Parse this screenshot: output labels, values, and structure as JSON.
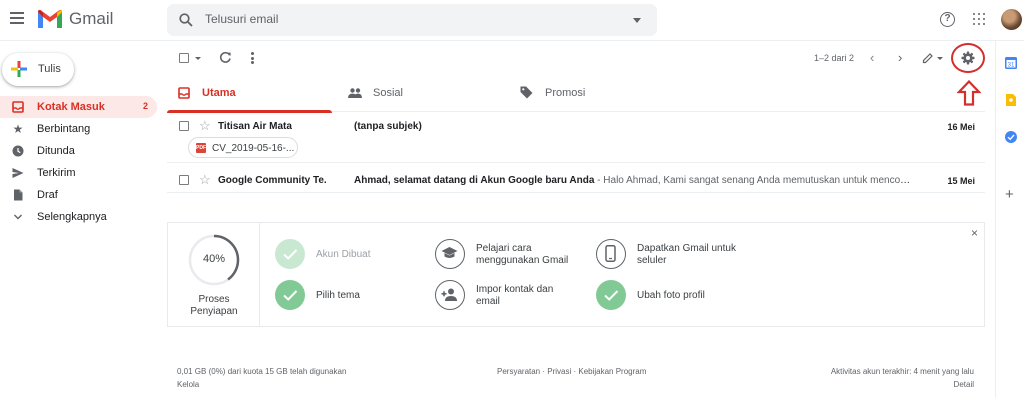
{
  "header": {
    "app_name": "Gmail",
    "search_placeholder": "Telusuri email",
    "help_label": "?"
  },
  "sidebar": {
    "compose_label": "Tulis",
    "items": [
      {
        "label": "Kotak Masuk",
        "count": "2",
        "icon": "inbox-icon",
        "active": true
      },
      {
        "label": "Berbintang",
        "icon": "star-icon"
      },
      {
        "label": "Ditunda",
        "icon": "clock-icon"
      },
      {
        "label": "Terkirim",
        "icon": "send-icon"
      },
      {
        "label": "Draf",
        "icon": "draft-icon"
      },
      {
        "label": "Selengkapnya",
        "icon": "chevron-down-icon"
      }
    ]
  },
  "toolbar": {
    "page_count": "1–2 dari 2"
  },
  "tabs": [
    {
      "label": "Utama",
      "icon": "inbox-icon",
      "active": true
    },
    {
      "label": "Sosial",
      "icon": "people-icon"
    },
    {
      "label": "Promosi",
      "icon": "tag-icon"
    }
  ],
  "emails": [
    {
      "sender": "Titisan Air Mata",
      "subject": "(tanpa subjek)",
      "snippet": "",
      "date": "16 Mei",
      "attachment": "CV_2019-05-16-..."
    },
    {
      "sender": "Google Community Te.",
      "subject": "Ahmad, selamat datang di Akun Google baru Anda",
      "snippet": " - Halo Ahmad, Kami sangat senang Anda memutuskan untuk mencoba Gm...",
      "date": "15 Mei"
    }
  ],
  "onboarding": {
    "progress_pct": "40%",
    "progress_value": 40,
    "progress_label_1": "Proses",
    "progress_label_2": "Penyiapan",
    "close_label": "×",
    "tasks": [
      {
        "line1": "Akun Dibuat",
        "line2": "",
        "state": "done-faded"
      },
      {
        "line1": "Pilih tema",
        "line2": "",
        "state": "done"
      },
      {
        "line1": "Pelajari cara",
        "line2": "menggunakan Gmail",
        "state": "todo",
        "icon": "graduation-cap-icon"
      },
      {
        "line1": "Impor kontak dan",
        "line2": "email",
        "state": "todo",
        "icon": "add-contact-icon"
      },
      {
        "line1": "Dapatkan Gmail untuk",
        "line2": "seluler",
        "state": "todo",
        "icon": "phone-icon"
      },
      {
        "line1": "Ubah foto profil",
        "line2": "",
        "state": "done"
      }
    ]
  },
  "footer": {
    "storage": "0,01 GB (0%) dari kuota 15 GB telah digunakan",
    "manage": "Kelola",
    "links": "Persyaratan · Privasi · Kebijakan Program",
    "activity": "Aktivitas akun terakhir: 4 menit yang lalu",
    "details": "Detail"
  },
  "colors": {
    "brand_red": "#d93025",
    "annotation_red": "#d32f2f",
    "done_green": "#81c995"
  },
  "side_panel": {
    "calendar_label": "31",
    "apps": [
      "calendar-icon",
      "keep-icon",
      "tasks-icon",
      "add-icon"
    ]
  }
}
